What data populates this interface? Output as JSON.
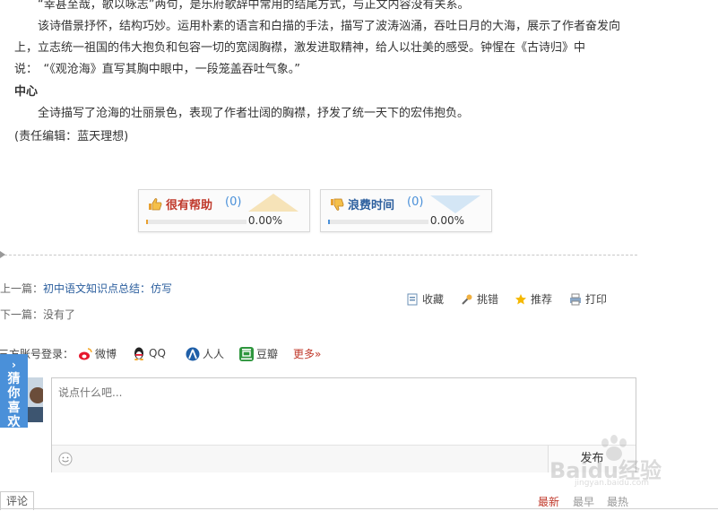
{
  "article": {
    "para1": "“幸甚至哉，歌以咏志”两句，是乐府歌辞中常用的结尾方式，与正文内容没有关系。",
    "para2": "该诗借景抒怀，结构巧妙。运用朴素的语言和白描的手法，描写了波涛汹涌，吞吐日月的大海，展示了作者奋发向上，立志统一祖国的伟大抱负和包容一切的宽阔胸襟，激发进取精神，给人以壮美的感受。钟惺在《古诗归》中说：　“《观沧海》直写其胸中眼中，一段笼盖吞吐气象。”",
    "heading": "中心",
    "para3": "全诗描写了沧海的壮丽景色，表现了作者壮阔的胸襟，抒发了统一天下的宏伟抱负。",
    "editor": "(责任编辑：蓝天理想)"
  },
  "votes": {
    "helpful": {
      "label": "很有帮助",
      "count": "(0)",
      "percent": "0.00%",
      "fraction": 0.0
    },
    "waste": {
      "label": "浪费时间",
      "count": "(0)",
      "percent": "0.00%",
      "fraction": 0.0
    }
  },
  "nav": {
    "prev_label": "上一篇：",
    "prev_link": "初中语文知识点总结：仿写",
    "next_label": "下一篇：",
    "next_text": "没有了"
  },
  "tools": {
    "collect": "收藏",
    "correct": "挑错",
    "recommend": "推荐",
    "print": "打印"
  },
  "login": {
    "label": "第三方账号登录：",
    "weibo": "微博",
    "qq": "QQ",
    "renren": "人人",
    "douban": "豆瓣",
    "more": "更多»"
  },
  "side_tab": {
    "label": "猜你喜欢"
  },
  "comment": {
    "placeholder": "说点什么吧...",
    "submit": "发布",
    "tab": "评论",
    "sort_latest": "最新",
    "sort_earliest": "最早",
    "sort_hottest": "最热"
  },
  "watermark": {
    "text": "Baidu经验",
    "sub": "jingyan.baidu.com"
  },
  "colors": {
    "link": "#2c5f9e",
    "helpful_label": "#c0392b",
    "waste_label": "#2c5f9e",
    "count": "#4a90d9",
    "side_tab_bg": "#4a90d9",
    "active_sort": "#c0392b",
    "more_link": "#c0392b"
  },
  "icons": {
    "helpful": "thumbs-up-icon",
    "waste": "thumbs-down-icon",
    "collect": "bookmark-icon",
    "correct": "wrench-icon",
    "recommend": "star-icon",
    "print": "printer-icon",
    "weibo": "weibo-icon",
    "qq": "qq-penguin-icon",
    "renren": "renren-icon",
    "douban": "douban-icon",
    "emoji": "smiley-icon"
  }
}
